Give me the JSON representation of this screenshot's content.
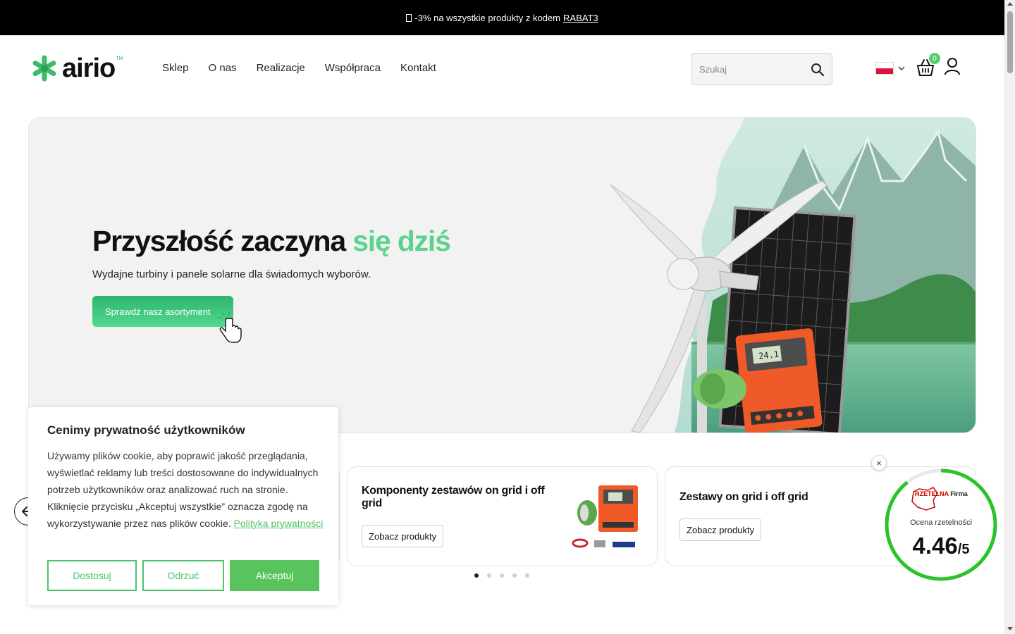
{
  "promo": {
    "text": "-3% na wszystkie produkty z kodem",
    "code": "RABAT3"
  },
  "header": {
    "logo": {
      "word": "airio",
      "tm": "TM"
    },
    "nav": [
      "Sklep",
      "O nas",
      "Realizacje",
      "Współpraca",
      "Kontakt"
    ],
    "search_placeholder": "Szukaj",
    "cart_count": "0",
    "language_flag": "flag-pl-icon"
  },
  "hero": {
    "title_main": "Przyszłość zaczyna ",
    "title_accent": "się dziś",
    "subtitle": "Wydajne turbiny i panele solarne dla świadomych wyborów.",
    "cta": "Sprawdź nasz asortyment",
    "accent_color": "#5bd38a"
  },
  "cards": [
    {
      "title": "Komponenty zestawów on grid i off grid",
      "button": "Zobacz produkty"
    },
    {
      "title": "Zestawy on grid i off grid",
      "button": "Zobacz produkty"
    }
  ],
  "slider": {
    "dots": 5,
    "active": 0
  },
  "cookie": {
    "title": "Cenimy prywatność użytkowników",
    "body": "Używamy plików cookie, aby poprawić jakość przeglądania, wyświetlać reklamy lub treści dostosowane do indywidualnych potrzeb użytkowników oraz analizować ruch na stronie. Kliknięcie przycisku „Akceptuj wszystkie” oznacza zgodę na wykorzystywanie przez nas plików cookie.",
    "link": "Polityka prywatności",
    "buttons": {
      "customize": "Dostosuj",
      "reject": "Odrzuć",
      "accept": "Akceptuj"
    }
  },
  "rating": {
    "brand_red": "RZETELNA",
    "brand_dark": "Firma",
    "label": "Ocena rzetelności",
    "score": "4.46",
    "max": "/5",
    "close": "×"
  }
}
